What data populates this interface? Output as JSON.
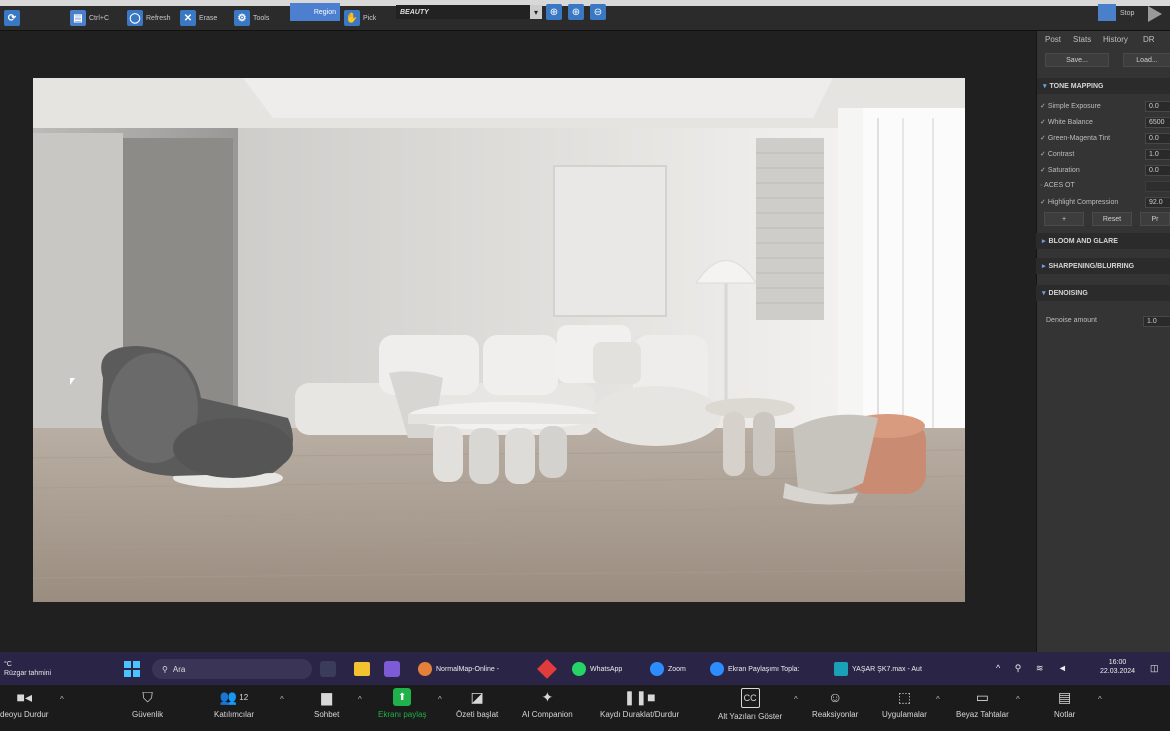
{
  "toolbar": {
    "copy_label": "Ctrl+C",
    "refresh_label": "Refresh",
    "erase_label": "Erase",
    "tools_label": "Tools",
    "region_label": "Region",
    "pick_label": "Pick",
    "channel_value": "BEAUTY",
    "stop_label": "Stop"
  },
  "panel": {
    "tabs": [
      "Post",
      "Stats",
      "History",
      "DR"
    ],
    "save_label": "Save...",
    "load_label": "Load...",
    "tone_mapping": {
      "title": "TONE MAPPING",
      "rows": [
        {
          "label": "Simple Exposure",
          "value": "0.0",
          "checked": true
        },
        {
          "label": "White Balance",
          "value": "6500",
          "checked": true
        },
        {
          "label": "Green-Magenta Tint",
          "value": "0.0",
          "checked": true
        },
        {
          "label": "Contrast",
          "value": "1.0",
          "checked": true
        },
        {
          "label": "Saturation",
          "value": "0.0",
          "checked": true
        },
        {
          "label": "ACES OT",
          "value": "",
          "checked": false
        },
        {
          "label": "Highlight Compression",
          "value": "92.0",
          "checked": true
        }
      ],
      "add_label": "+",
      "reset_label": "Reset",
      "preset_label": "Pr"
    },
    "bloom_title": "BLOOM AND GLARE",
    "sharpen_title": "SHARPENING/BLURRING",
    "denoise": {
      "title": "DENOISING",
      "amount_label": "Denoise amount",
      "amount_value": "1.0"
    }
  },
  "taskbar": {
    "weather_temp": "°C",
    "weather_text": "Rüzgar tahmini",
    "search_placeholder": "Ara",
    "apps": [
      {
        "label": "NormalMap-Online -",
        "color": "#e4803a"
      },
      {
        "label": "WhatsApp",
        "color": "#25d366"
      },
      {
        "label": "Zoom",
        "color": "#2d8cff"
      },
      {
        "label": "Ekran Paylaşımı Topla:",
        "color": "#2d8cff"
      },
      {
        "label": "YAŞAR ŞK7.max - Aut",
        "color": "#1aa1b8"
      }
    ],
    "time": "16:00",
    "date": "22.03.2024"
  },
  "zoombar": {
    "items": [
      {
        "label": "deoyu Durdur",
        "icon": "■◂"
      },
      {
        "label": "Güvenlik",
        "icon": "⛉"
      },
      {
        "label": "Katılımcılar",
        "icon": "👥",
        "count": "12"
      },
      {
        "label": "Sohbet",
        "icon": "▆"
      },
      {
        "label": "Ekranı paylaş",
        "icon": "⬆"
      },
      {
        "label": "Özeti başlat",
        "icon": "◪"
      },
      {
        "label": "AI Companion",
        "icon": "✦"
      },
      {
        "label": "Kaydı Duraklat/Durdur",
        "icon": "❚❚■"
      },
      {
        "label": "Alt Yazıları Göster",
        "icon": "CC"
      },
      {
        "label": "Reaksiyonlar",
        "icon": "☺"
      },
      {
        "label": "Uygulamalar",
        "icon": "⬚"
      },
      {
        "label": "Beyaz Tahtalar",
        "icon": "▭"
      },
      {
        "label": "Notlar",
        "icon": "▤"
      }
    ]
  },
  "colors": {
    "accent": "#3b78c4",
    "share_green": "#1fb14a",
    "panel_bg": "#343434",
    "taskbar_bg": "#2a2547"
  }
}
